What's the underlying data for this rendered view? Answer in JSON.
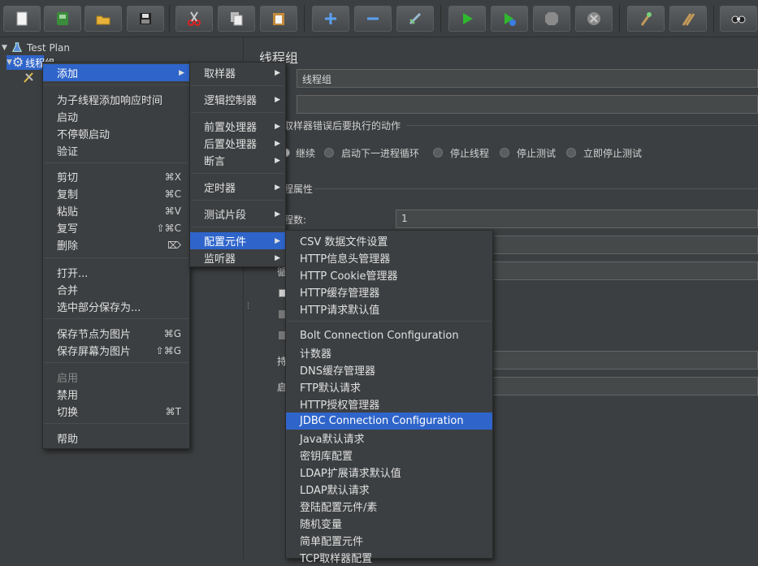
{
  "colors": {
    "background": "#3c3f41",
    "selection": "#2f65ca",
    "run_green": "#2fb82f",
    "field_bg": "#45494a"
  },
  "toolbar": {
    "buttons": [
      {
        "icon": "new-document-icon"
      },
      {
        "icon": "templates-icon"
      },
      {
        "icon": "open-folder-icon"
      },
      {
        "icon": "save-icon"
      },
      {
        "icon": "cut-icon"
      },
      {
        "icon": "copy-icon"
      },
      {
        "icon": "paste-icon"
      },
      {
        "icon": "expand-icon"
      },
      {
        "icon": "collapse-icon"
      },
      {
        "icon": "toggle-icon"
      },
      {
        "icon": "start-icon"
      },
      {
        "icon": "start-no-pauses-icon"
      },
      {
        "icon": "stop-icon"
      },
      {
        "icon": "shutdown-icon"
      },
      {
        "icon": "clear-icon"
      },
      {
        "icon": "clear-all-icon"
      },
      {
        "icon": "search-icon"
      }
    ]
  },
  "tree": {
    "items": [
      {
        "label": "Test Plan"
      },
      {
        "label": "线程组"
      }
    ]
  },
  "main": {
    "title": "线程组",
    "name_value": "线程组",
    "comment_value": "",
    "sampler_error_label": "取样器错误后要执行的动作",
    "radio_options": [
      "继续",
      "启动下一进程循环",
      "停止线程",
      "停止测试",
      "立即停止测试"
    ],
    "thread_props_label": "线程属性",
    "threads_label": "线程数:",
    "threads_value": "1",
    "partial_label_1": "循",
    "partial_label_2": "持",
    "partial_label_3": "启"
  },
  "context_menu": {
    "items": [
      {
        "label": "添加",
        "shortcut": "",
        "submenu": true,
        "selected": true
      },
      {
        "label": "为子线程添加响应时间",
        "shortcut": ""
      },
      {
        "label": "启动",
        "shortcut": ""
      },
      {
        "label": "不停顿启动",
        "shortcut": ""
      },
      {
        "label": "验证",
        "shortcut": ""
      },
      {
        "label": "剪切",
        "shortcut": "⌘X"
      },
      {
        "label": "复制",
        "shortcut": "⌘C"
      },
      {
        "label": "粘贴",
        "shortcut": "⌘V"
      },
      {
        "label": "复写",
        "shortcut": "⇧⌘C"
      },
      {
        "label": "删除",
        "shortcut": "⌦"
      },
      {
        "label": "打开...",
        "shortcut": ""
      },
      {
        "label": "合并",
        "shortcut": ""
      },
      {
        "label": "选中部分保存为...",
        "shortcut": ""
      },
      {
        "label": "保存节点为图片",
        "shortcut": "⌘G"
      },
      {
        "label": "保存屏幕为图片",
        "shortcut": "⇧⌘G"
      },
      {
        "label": "启用",
        "shortcut": "",
        "disabled": true
      },
      {
        "label": "禁用",
        "shortcut": ""
      },
      {
        "label": "切换",
        "shortcut": "⌘T"
      },
      {
        "label": "帮助",
        "shortcut": ""
      }
    ]
  },
  "add_submenu": {
    "items": [
      {
        "label": "取样器"
      },
      {
        "label": "逻辑控制器"
      },
      {
        "label": "前置处理器"
      },
      {
        "label": "后置处理器"
      },
      {
        "label": "断言"
      },
      {
        "label": "定时器"
      },
      {
        "label": "测试片段"
      },
      {
        "label": "配置元件"
      },
      {
        "label": "监听器"
      }
    ]
  },
  "config_submenu": {
    "items": [
      {
        "label": "CSV 数据文件设置"
      },
      {
        "label": "HTTP信息头管理器"
      },
      {
        "label": "HTTP Cookie管理器"
      },
      {
        "label": "HTTP缓存管理器"
      },
      {
        "label": "HTTP请求默认值"
      },
      {
        "label": "Bolt Connection Configuration"
      },
      {
        "label": "计数器"
      },
      {
        "label": "DNS缓存管理器"
      },
      {
        "label": "FTP默认请求"
      },
      {
        "label": "HTTP授权管理器"
      },
      {
        "label": "JDBC Connection Configuration"
      },
      {
        "label": "Java默认请求"
      },
      {
        "label": "密钥库配置"
      },
      {
        "label": "LDAP扩展请求默认值"
      },
      {
        "label": "LDAP默认请求"
      },
      {
        "label": "登陆配置元件/素"
      },
      {
        "label": "随机变量"
      },
      {
        "label": "简单配置元件"
      },
      {
        "label": "TCP取样器配置"
      }
    ]
  }
}
